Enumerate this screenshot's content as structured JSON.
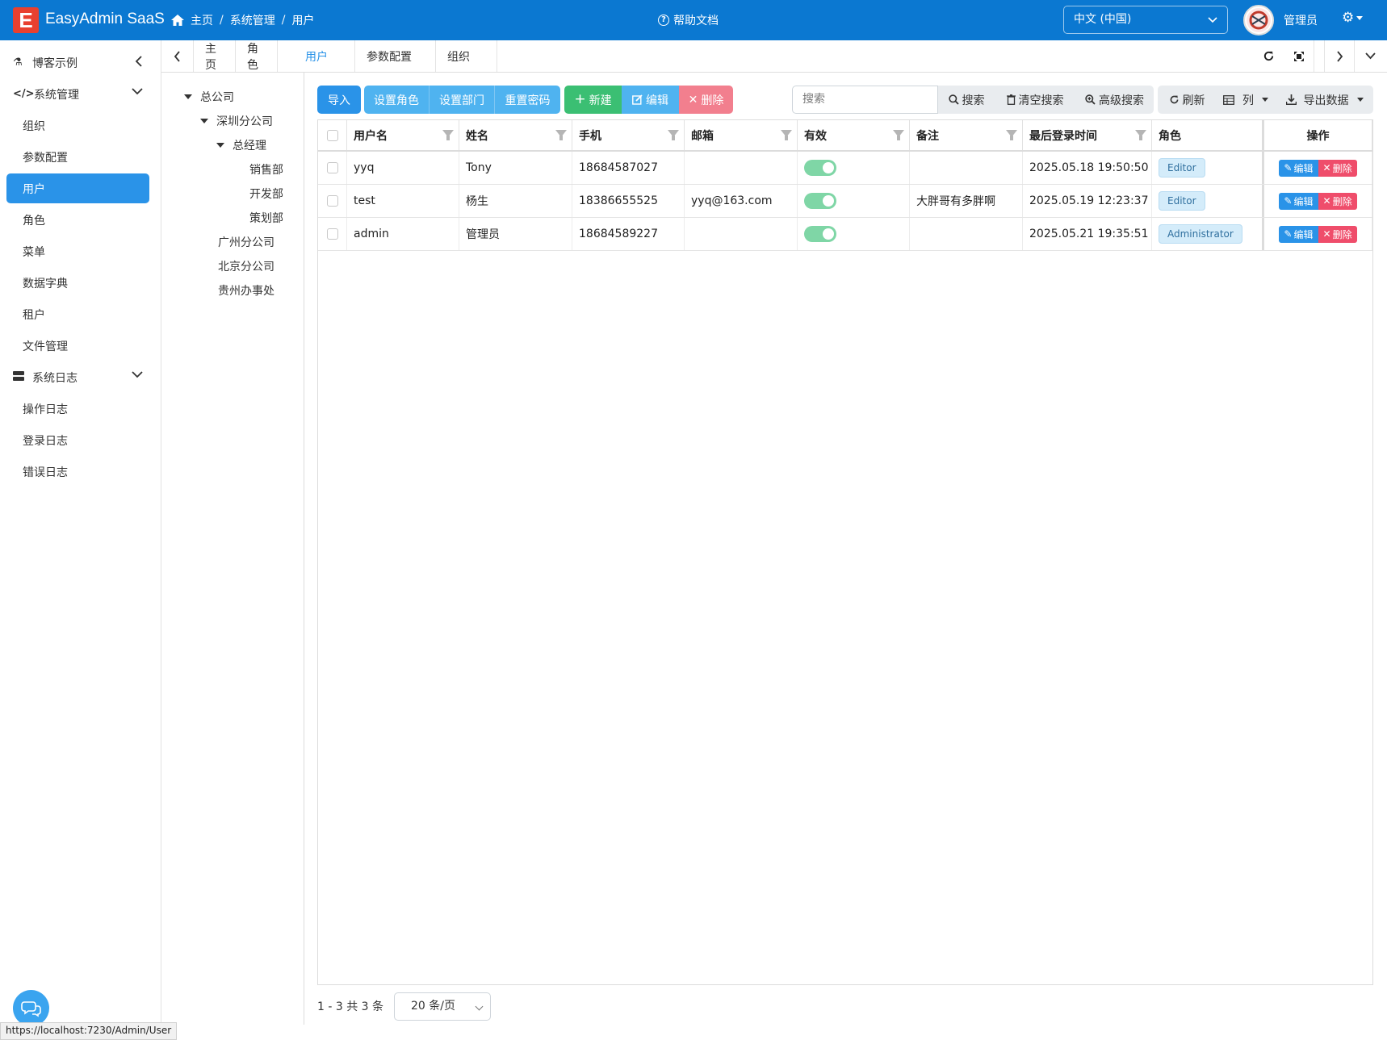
{
  "header": {
    "logo_letter": "E",
    "app_title": "EasyAdmin SaaS",
    "breadcrumb": [
      "主页",
      "系统管理",
      "用户"
    ],
    "breadcrumb_sep": "/",
    "help": "帮助文档",
    "language": "中文 (中国)",
    "user": "管理员",
    "brand_color": "#0b78d1"
  },
  "sidebar": {
    "groups": [
      {
        "label": "博客示例",
        "icon": "flask-icon"
      },
      {
        "label": "系统管理",
        "icon": "code-icon"
      },
      {
        "label": "系统日志",
        "icon": "server-icon"
      }
    ],
    "system_items": [
      "组织",
      "参数配置",
      "用户",
      "角色",
      "菜单",
      "数据字典",
      "租户",
      "文件管理"
    ],
    "log_items": [
      "操作日志",
      "登录日志",
      "错误日志"
    ],
    "active": "用户"
  },
  "tabs": [
    "主页",
    "角色",
    "用户",
    "参数配置",
    "组织"
  ],
  "tree": {
    "root": "总公司",
    "shenzhen": "深圳分公司",
    "gm": "总经理",
    "sales": "销售部",
    "dev": "开发部",
    "plan": "策划部",
    "guangzhou": "广州分公司",
    "beijing": "北京分公司",
    "guizhou": "贵州办事处"
  },
  "toolbar": {
    "import": "导入",
    "set_role": "设置角色",
    "set_dept": "设置部门",
    "reset_pwd": "重置密码",
    "new": "新建",
    "edit": "编辑",
    "delete": "删除",
    "search_placeholder": "搜索",
    "search": "搜索",
    "clear_search": "清空搜索",
    "advanced_search": "高级搜索",
    "refresh": "刷新",
    "columns": "列",
    "export": "导出数据"
  },
  "table": {
    "headers": [
      "用户名",
      "姓名",
      "手机",
      "邮箱",
      "有效",
      "备注",
      "最后登录时间",
      "角色",
      "操作"
    ],
    "rows": [
      {
        "username": "yyq",
        "name": "Tony",
        "phone": "18684587027",
        "email": "",
        "valid": true,
        "remark": "",
        "last_login": "2025.05.18 19:50:50",
        "role": "Editor"
      },
      {
        "username": "test",
        "name": "杨生",
        "phone": "18386655525",
        "email": "yyq@163.com",
        "valid": true,
        "remark": "大胖哥有多胖啊",
        "last_login": "2025.05.19 12:23:37",
        "role": "Editor"
      },
      {
        "username": "admin",
        "name": "管理员",
        "phone": "18684589227",
        "email": "",
        "valid": true,
        "remark": "",
        "last_login": "2025.05.21 19:35:51",
        "role": "Administrator"
      }
    ],
    "row_edit": "编辑",
    "row_delete": "删除"
  },
  "pager": {
    "info": "1 - 3 共 3 条",
    "page_size": "20 条/页"
  },
  "status_url": "https://localhost:7230/Admin/User"
}
